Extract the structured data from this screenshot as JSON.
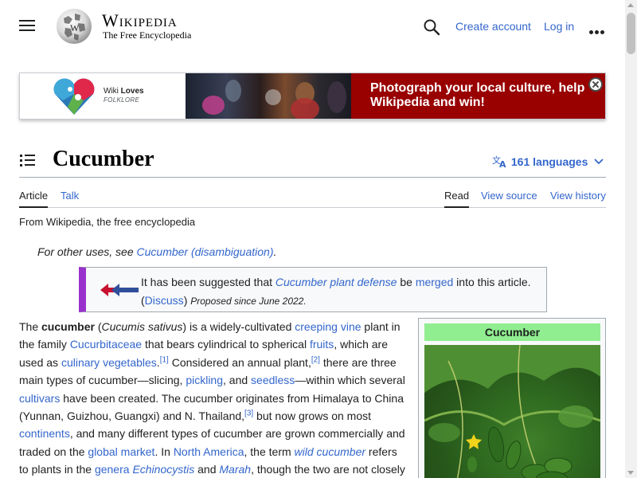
{
  "header": {
    "menu_icon": "hamburger-menu-icon",
    "wordmark": "Wikipedia",
    "tagline": "The Free Encyclopedia",
    "search_icon": "search-icon",
    "create_account": "Create account",
    "log_in": "Log in",
    "more_icon": "ellipsis-icon"
  },
  "banner": {
    "logo_line1_prefix": "Wiki ",
    "logo_line1_bold": "Loves",
    "logo_line2": "FOLKLORE",
    "cta": "Photograph your local culture, help Wikipedia and win!",
    "close_icon": "close-icon",
    "accent": "#990000"
  },
  "page": {
    "title": "Cucumber",
    "languages": "161 languages",
    "from": "From Wikipedia, the free encyclopedia"
  },
  "tabs": {
    "article": "Article",
    "talk": "Talk",
    "read": "Read",
    "view_source": "View source",
    "view_history": "View history"
  },
  "hatnote": {
    "prefix": "For other uses, see ",
    "link": "Cucumber (disambiguation)",
    "suffix": "."
  },
  "merge": {
    "t1": "It has been suggested that ",
    "l1": "Cucumber plant defense",
    "t2": " be ",
    "l2": "merged",
    "t3": " into this article. (",
    "l3": "Discuss",
    "t4": ") ",
    "since": "Proposed since June 2022.",
    "accent": "#9932cc"
  },
  "article": {
    "s01": "The ",
    "s02": "cucumber",
    "s03": " (",
    "s04": "Cucumis sativus",
    "s05": ") is a widely-cultivated ",
    "l01": "creeping vine",
    "s06": " plant in the family ",
    "l02": "Cucurbitaceae",
    "s07": " that bears cylindrical to spherical ",
    "l03": "fruits",
    "s08": ", which are used as ",
    "l04": "culinary vegetables",
    "s09": ".",
    "ref1": "[1]",
    "s10": " Considered an annual plant,",
    "ref2": "[2]",
    "s11": " there are three main types of cucumber—slicing, ",
    "l05": "pickling",
    "s12": ", and ",
    "l06": "seedless",
    "s13": "—within which several ",
    "l07": "cultivars",
    "s14": " have been created. The cucumber originates from Himalaya to China (Yunnan, Guizhou, Guangxi) and N. Thailand,",
    "ref3": "[3]",
    "s15": " but now grows on most ",
    "l08": "continents",
    "s16": ", and many different types of cucumber are grown commercially and traded on the ",
    "l09": "global market",
    "s17": ". In ",
    "l10": "North America",
    "s18": ", the term ",
    "l11": "wild cucumber",
    "s19": " refers to plants in the ",
    "l12": "genera",
    "s20": " ",
    "l13": "Echinocystis",
    "s21": " and ",
    "l14": "Marah",
    "s22": ", though the two are not closely"
  },
  "infobox": {
    "title": "Cucumber",
    "header_color": "#90ee90"
  }
}
